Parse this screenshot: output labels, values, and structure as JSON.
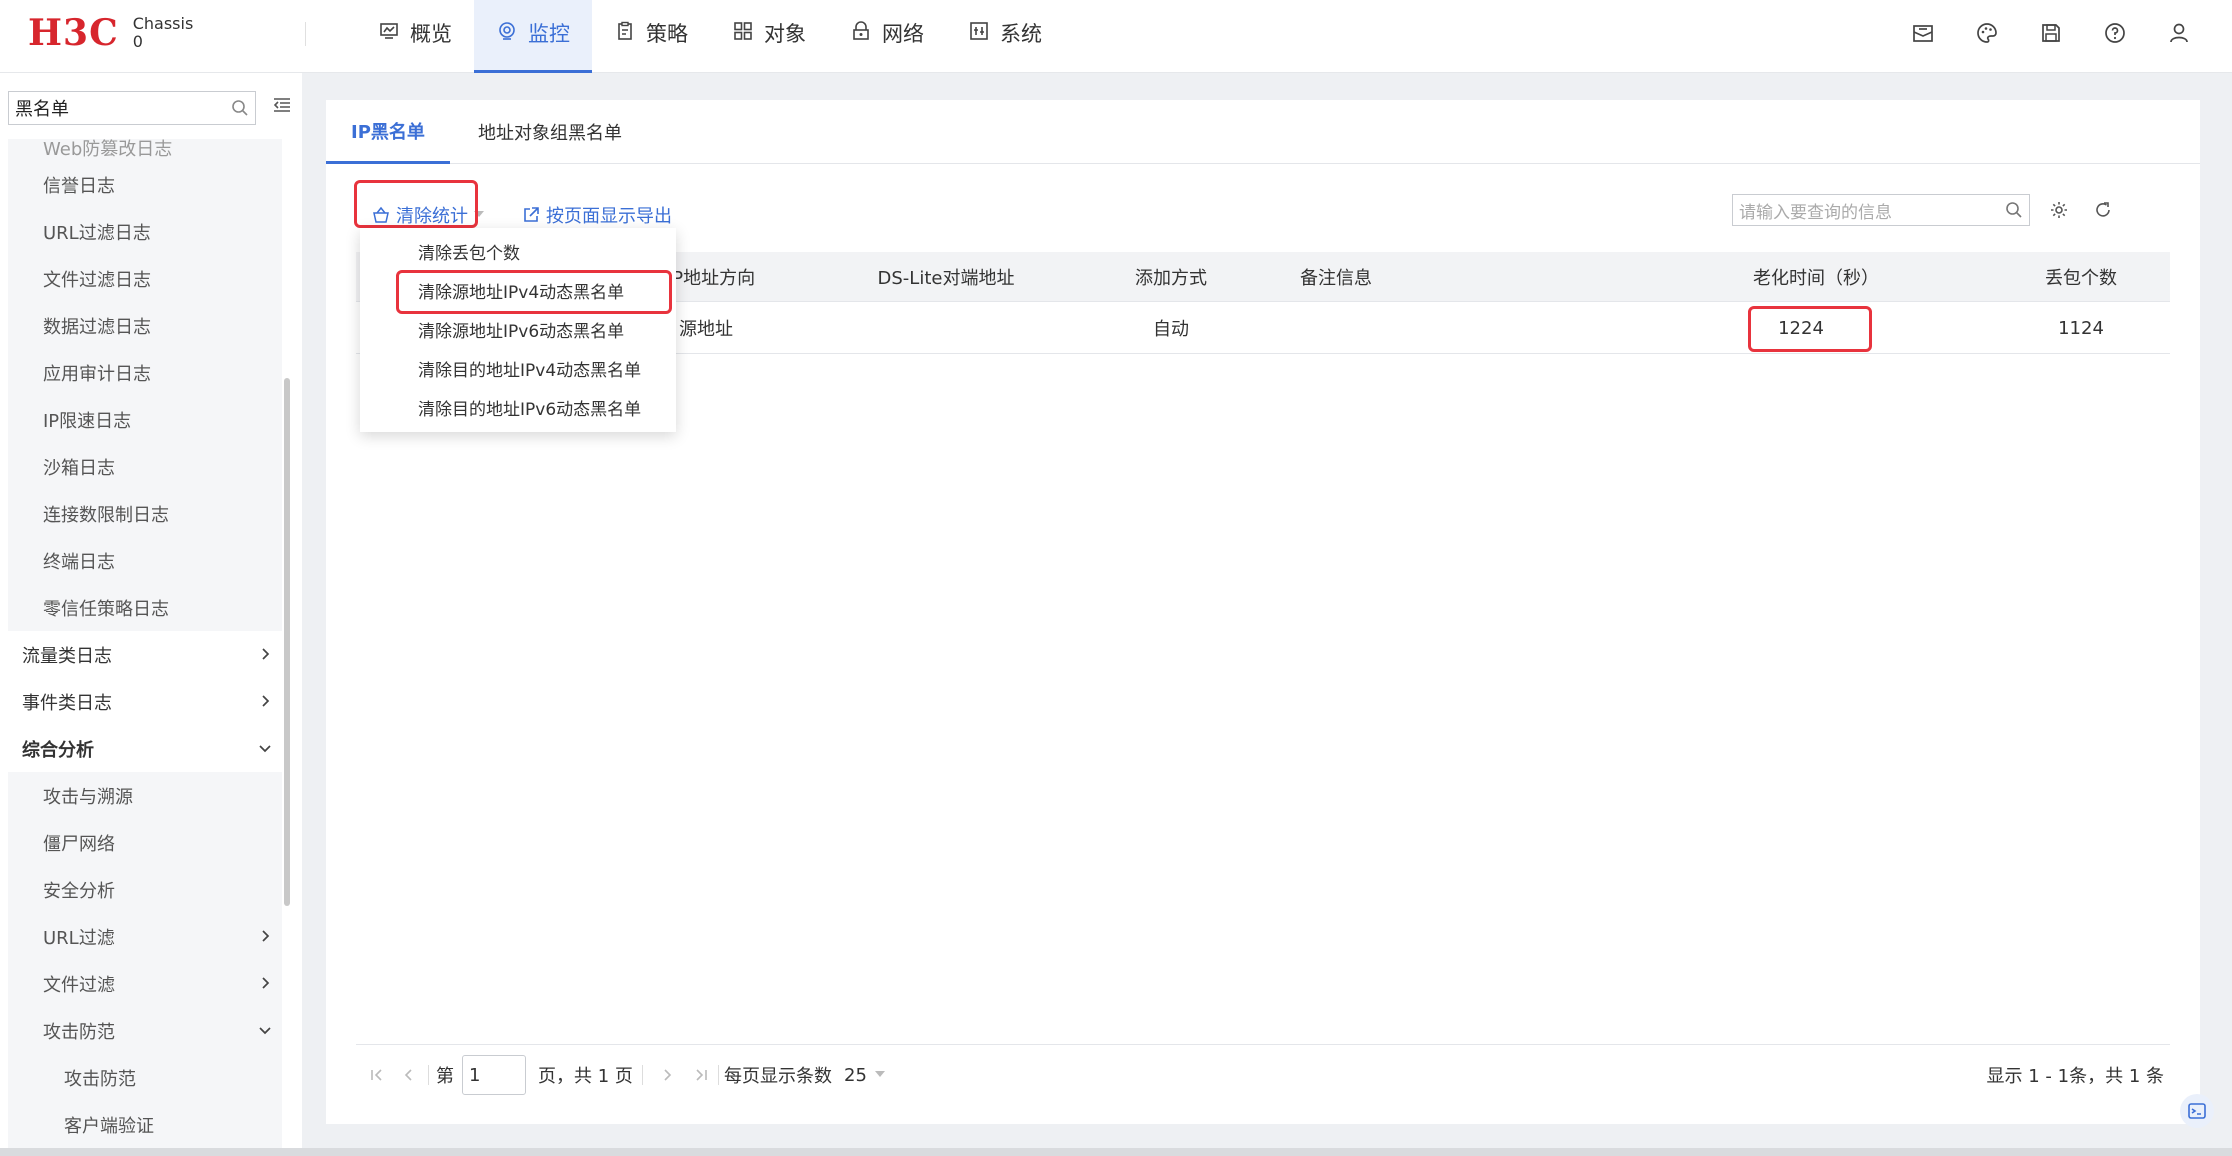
{
  "header": {
    "logo": "H3C",
    "device_line1": "Chassis",
    "device_line2": "0",
    "nav": [
      {
        "label": "概览",
        "icon": "monitor-icon"
      },
      {
        "label": "监控",
        "icon": "monitor-eye-icon",
        "active": true
      },
      {
        "label": "策略",
        "icon": "clipboard-icon"
      },
      {
        "label": "对象",
        "icon": "grid-icon"
      },
      {
        "label": "网络",
        "icon": "network-lock-icon"
      },
      {
        "label": "系统",
        "icon": "system-icon"
      }
    ],
    "icons": [
      "mail-icon",
      "palette-icon",
      "save-icon",
      "help-icon",
      "user-icon"
    ]
  },
  "sidebar": {
    "search_value": "黑名单",
    "items": [
      {
        "label": "Web防篡改日志",
        "level": 2,
        "cut": true
      },
      {
        "label": "信誉日志",
        "level": 2
      },
      {
        "label": "URL过滤日志",
        "level": 2
      },
      {
        "label": "文件过滤日志",
        "level": 2
      },
      {
        "label": "数据过滤日志",
        "level": 2
      },
      {
        "label": "应用审计日志",
        "level": 2
      },
      {
        "label": "IP限速日志",
        "level": 2
      },
      {
        "label": "沙箱日志",
        "level": 2
      },
      {
        "label": "连接数限制日志",
        "level": 2
      },
      {
        "label": "终端日志",
        "level": 2
      },
      {
        "label": "零信任策略日志",
        "level": 2
      },
      {
        "label": "流量类日志",
        "level": 1,
        "chevron": "right"
      },
      {
        "label": "事件类日志",
        "level": 1,
        "chevron": "right"
      },
      {
        "label": "综合分析",
        "level": 1,
        "chevron": "down",
        "open": true
      },
      {
        "label": "攻击与溯源",
        "level": 2
      },
      {
        "label": "僵尸网络",
        "level": 2
      },
      {
        "label": "安全分析",
        "level": 2
      },
      {
        "label": "URL过滤",
        "level": 2,
        "chevron": "right"
      },
      {
        "label": "文件过滤",
        "level": 2,
        "chevron": "right"
      },
      {
        "label": "攻击防范",
        "level": 2,
        "chevron": "down"
      },
      {
        "label": "攻击防范",
        "level": 3
      },
      {
        "label": "客户端验证",
        "level": 3
      }
    ]
  },
  "tabs": [
    {
      "label": "IP黑名单",
      "active": true
    },
    {
      "label": "地址对象组黑名单"
    }
  ],
  "toolbar": {
    "clear_stats": "清除统计",
    "export": "按页面显示导出",
    "search_placeholder": "请输入要查询的信息"
  },
  "dropdown": [
    "清除丢包个数",
    "清除源地址IPv4动态黑名单",
    "清除源地址IPv6动态黑名单",
    "清除目的地址IPv4动态黑名单",
    "清除目的地址IPv6动态黑名单"
  ],
  "table": {
    "columns": [
      "IP地址方向",
      "DS-Lite对端地址",
      "添加方式",
      "备注信息",
      "老化时间（秒）",
      "丢包个数"
    ],
    "rows": [
      {
        "direction": "源地址",
        "dslite": "",
        "method": "自动",
        "note": "",
        "aging": "1224",
        "drops": "1124"
      }
    ]
  },
  "pager": {
    "page_prefix": "第",
    "page_value": "1",
    "page_suffix": "页，共 1 页",
    "per_page_label": "每页显示条数",
    "per_page_value": "25",
    "summary": "显示 1 - 1条，共 1 条"
  },
  "colors": {
    "accent": "#3b6fd6",
    "highlight": "#e8333d",
    "brand": "#d7262d"
  }
}
